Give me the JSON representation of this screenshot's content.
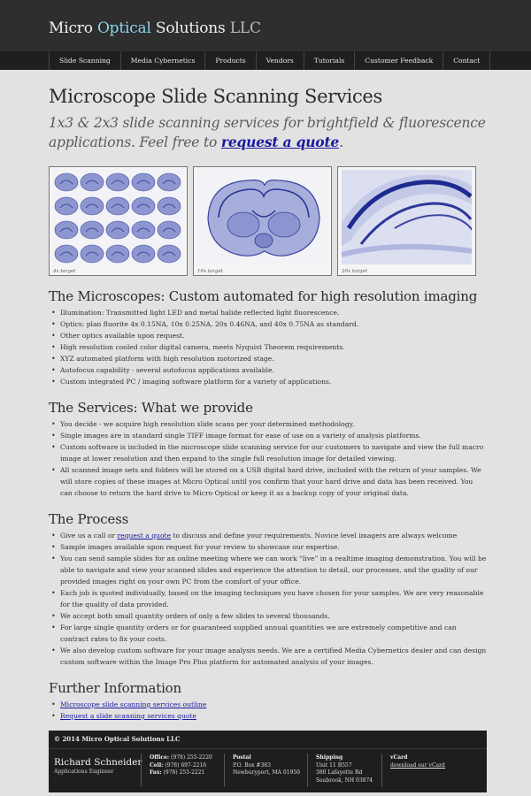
{
  "header": {
    "logo_part1": "Micro ",
    "logo_part2": "Optical",
    "logo_part3": " Solutions ",
    "logo_part4": "LLC"
  },
  "nav": {
    "items": [
      "Slide Scanning",
      "Media Cybernetics",
      "Products",
      "Vendors",
      "Tutorials",
      "Customer Feedback",
      "Contact"
    ]
  },
  "main": {
    "title": "Microscope Slide Scanning Services",
    "subtitle_text": "1x3 & 2x3 slide scanning services for brightfield & fluorescence applications. Feel free to ",
    "subtitle_link": "request a quote",
    "subtitle_end": ".",
    "gallery": [
      {
        "caption": "4x target"
      },
      {
        "caption": "10x target"
      },
      {
        "caption": "20x target"
      }
    ]
  },
  "sections": {
    "microscopes": {
      "title": "The Microscopes: Custom automated for high resolution imaging",
      "items": [
        "Illumination: Transmitted light LED and metal halide reflected light fluorescence.",
        "Optics: plan fluorite 4x 0.15NA, 10x 0.25NA, 20x 0.46NA, and 40x 0.75NA as standard.",
        "Other optics available upon request.",
        "High resolution cooled color digital camera, meets Nyquist Theorem requirements.",
        "XYZ automated platform with high resolution motorized stage.",
        "Autofocus capability - several autofocus applications available.",
        "Custom integrated PC / imaging software platform for a variety of applications."
      ]
    },
    "services": {
      "title": "The Services: What we provide",
      "items": [
        "You decide - we acquire high resolution slide scans per your determined methodology.",
        "Single images are in standard single TIFF image format for ease of use on a variety of analysis platforms.",
        "Custom software is included in the microscope slide scanning service for our customers to navigate and view the full macro image at lower resolution and then expand to the single full resolution image for detailed viewing.",
        "All scanned image sets and folders will be stored on a USB digital hard drive, included with the return of your samples. We will store copies of these images at Micro Optical until you confirm that your hard drive and data has been received. You can choose to return the hard drive to Micro Optical or keep it as a backup copy of your original data."
      ]
    },
    "process": {
      "title": "The Process",
      "item0_pre": "Give us a call or ",
      "item0_link": "request a quote",
      "item0_post": " to discuss and define your requirements. Novice level imagers are always welcome",
      "items": [
        "Sample images available upon request for your review to showcase our expertise.",
        "You can send sample slides for an online meeting where we can work “live” in a realtime imaging demonstration. You will be able to navigate and view your scanned slides and experience the attention to detail, our processes, and the quality of our provided images right on your own PC from the comfort of your office.",
        "Each job is quoted individually, based on the imaging techniques you have chosen for your samples. We are very reasonable for the quality of data provided.",
        "We accept both small quantity orders of only a few slides to several thousands.",
        "For large single quantity orders or for guaranteed supplied annual quantities we are extremely competitive and can contract rates to fix your costs.",
        "We also develop custom software for your image analysis needs. We are a certified Media Cybernetics dealer and can design custom software within the Image Pro Plus platform for automated analysis of your images."
      ]
    },
    "further": {
      "title": "Further Information",
      "links": [
        "Microscope slide scanning services outline",
        "Request a slide scanning services quote"
      ]
    }
  },
  "footer": {
    "copyright": "© 2014 Micro Optical Solutions LLC",
    "name": "Richard Schneider",
    "role": "Applications Engineer",
    "office_label": "Office:",
    "office": "(978) 255-2220",
    "cell_label": "Cell:",
    "cell": "(978) 697-2216",
    "fax_label": "Fax:",
    "fax": "(978) 255-2221",
    "postal_head": "Postal",
    "postal_1": "P.O. Box #383",
    "postal_2": "Newburyport, MA 01950",
    "shipping_head": "Shipping",
    "shipping_1": "Unit 11 B557",
    "shipping_2": "380 Lafayette Rd",
    "shipping_3": "Seabrook, NH 03874",
    "vcard_head": "vCard",
    "vcard_link": "download our vCard"
  }
}
